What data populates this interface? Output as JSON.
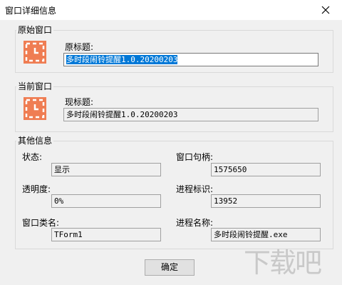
{
  "window": {
    "title": "窗口详细信息"
  },
  "original_group": {
    "title": "原始窗口",
    "label": "原标题:",
    "value": "多时段闹铃提醒1.0.20200203"
  },
  "current_group": {
    "title": "当前窗口",
    "label": "现标题:",
    "value": "多时段闹铃提醒1.0.20200203"
  },
  "other_group": {
    "title": "其他信息",
    "status_label": "状态:",
    "status_value": "显示",
    "handle_label": "窗口句柄:",
    "handle_value": "1575650",
    "opacity_label": "透明度:",
    "opacity_value": "0%",
    "process_id_label": "进程标识:",
    "process_id_value": "13952",
    "class_label": "窗口类名:",
    "class_value": "TForm1",
    "process_name_label": "进程名称:",
    "process_name_value": "多时段闹铃提醒.exe"
  },
  "buttons": {
    "ok": "确定"
  },
  "icons": {
    "app": "clock-icon",
    "close": "close-icon"
  },
  "colors": {
    "icon_bg": "#ef7d53",
    "selection": "#0078d7"
  },
  "watermark": {
    "text": "下载吧"
  }
}
